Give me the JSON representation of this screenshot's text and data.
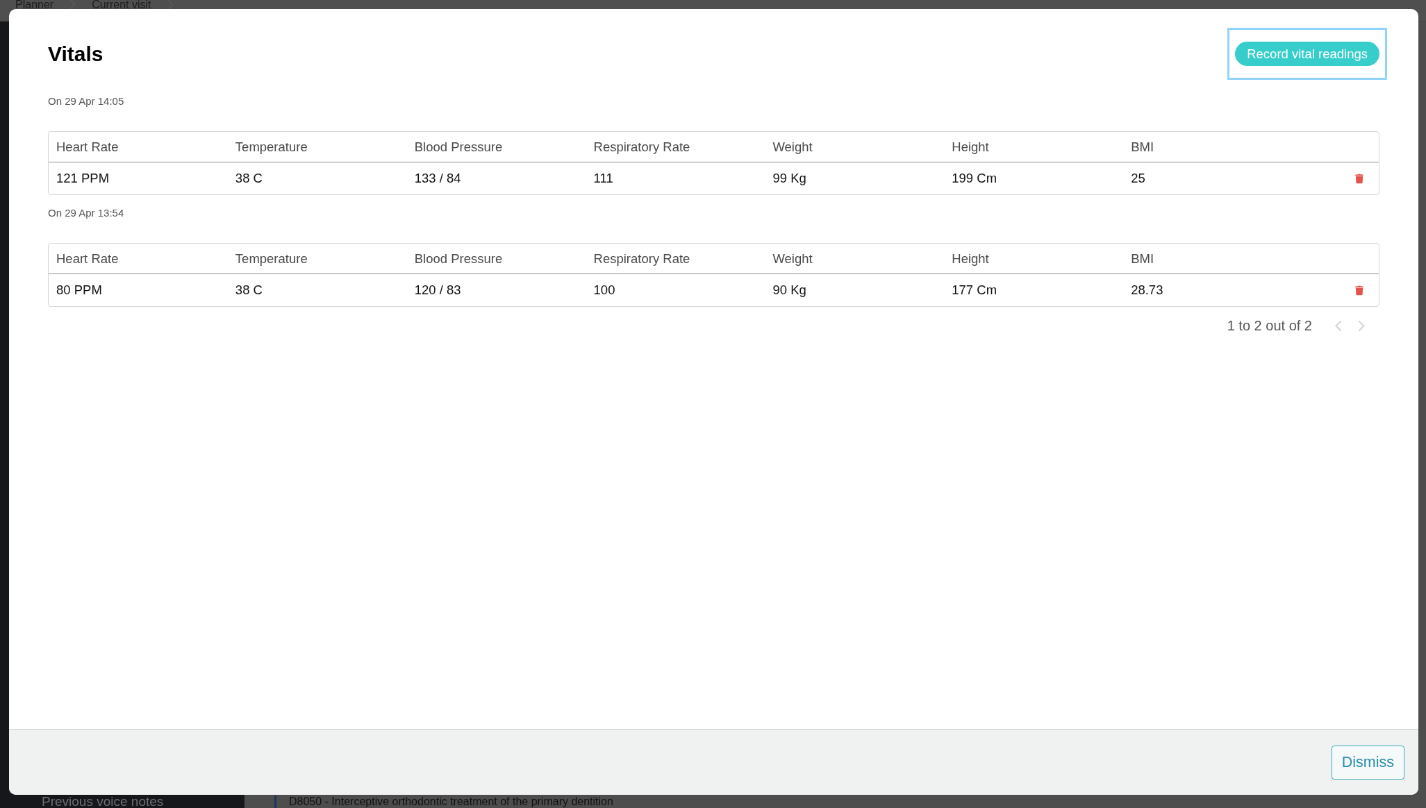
{
  "background": {
    "breadcrumbs": [
      "Planner",
      "Current visit"
    ],
    "sidebar_item": "Previous voice notes",
    "procedure": "D8050 - Interceptive orthodontic treatment of the primary dentition"
  },
  "dialog": {
    "title": "Vitals",
    "record_button": {
      "label": "Record vital readings",
      "focused": true
    },
    "readings": [
      {
        "date": "On 29 Apr 14:05",
        "columns": [
          "Heart Rate",
          "Temperature",
          "Blood Pressure",
          "Respiratory Rate",
          "Weight",
          "Height",
          "BMI"
        ],
        "values": [
          "121 PPM",
          "38 C",
          "133 / 84",
          "111",
          "99 Kg",
          "199 Cm",
          "25"
        ]
      },
      {
        "date": "On 29 Apr 13:54",
        "columns": [
          "Heart Rate",
          "Temperature",
          "Blood Pressure",
          "Respiratory Rate",
          "Weight",
          "Height",
          "BMI"
        ],
        "values": [
          "80 PPM",
          "38 C",
          "120 / 83",
          "100",
          "90 Kg",
          "177 Cm",
          "28.73"
        ]
      }
    ],
    "pagination": {
      "summary": "1 to 2 out of 2",
      "previous_disabled": true,
      "next_disabled": true
    },
    "dismiss_button": "Dismiss"
  }
}
